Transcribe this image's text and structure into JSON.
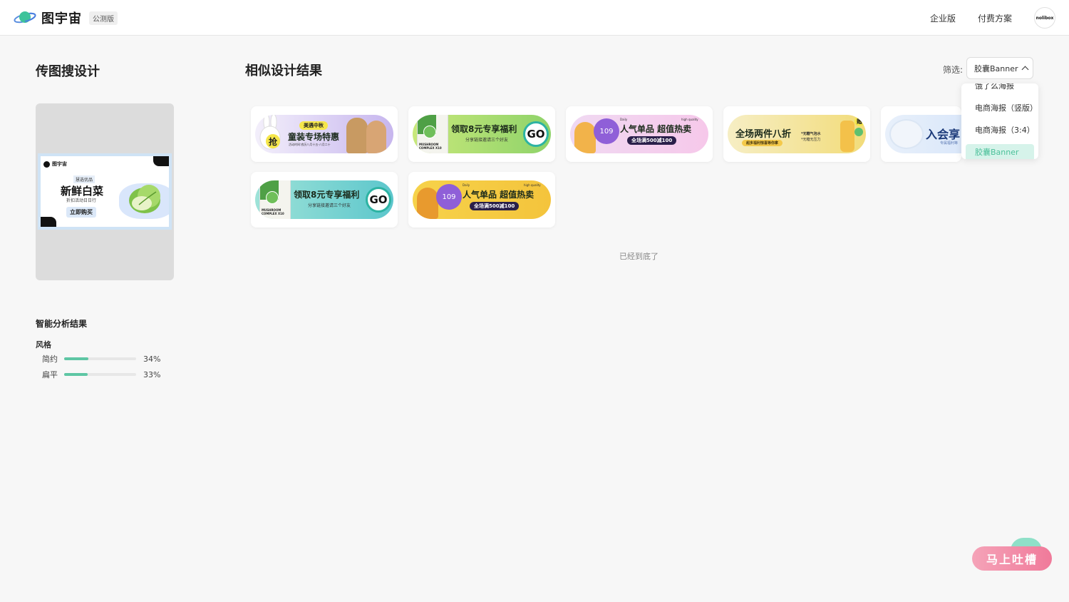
{
  "header": {
    "app_name": "图宇宙",
    "beta_label": "公测版",
    "nav": [
      "企业版",
      "付费方案"
    ],
    "avatar_text": "nolibox"
  },
  "left": {
    "title": "传图搜设计",
    "query_image": {
      "logo": "图宇宙",
      "tag": "慧选优品",
      "title": "新鲜白菜",
      "subtitle": "折扣活动日日行",
      "button": "立即购买"
    },
    "analysis_title": "智能分析结果",
    "style_label": "风格",
    "metrics": [
      {
        "name": "简约",
        "value": "34%",
        "fraction": 0.34
      },
      {
        "name": "扁平",
        "value": "33%",
        "fraction": 0.33
      }
    ]
  },
  "main": {
    "title": "相似设计结果",
    "filter_label": "筛选:",
    "filter_value": "胶囊Banner",
    "dropdown": [
      "饿了么海报",
      "电商海报（竖版）",
      "电商海报（3:4）",
      "胶囊Banner"
    ],
    "end_text": "已经到底了",
    "results": [
      {
        "tag": "美遇中秋",
        "badge": "抢",
        "title": "童装专场特惠",
        "sub": "活动时间:农历八月十五-八月二十"
      },
      {
        "title": "领取8元专享福利",
        "sub": "分享链接邀请三个好友",
        "go": "GO",
        "box": "MUSHROOM COMPLEX X10"
      },
      {
        "price": "109",
        "title": "人气单品  超值热卖",
        "pill": "全场满500减100",
        "daily": "Daily",
        "hq": "high quality"
      },
      {
        "title": "全场两件八折",
        "sub": "超多福利惊喜等你拿",
        "note1": "*无糖气泡水",
        "note2": "*无糖无压力",
        "gift": "赠"
      },
      {
        "title": "入会享",
        "sub": "专属福利等"
      },
      {
        "title": "领取8元专享福利",
        "sub": "分享链接邀请三个好友",
        "go": "GO",
        "box": "MUSHROOM COMPLEX X10"
      },
      {
        "price": "109",
        "title": "人气单品  超值热卖",
        "pill": "全场满500减100",
        "daily": "Daily",
        "hq": "high quality"
      }
    ]
  },
  "feedback": "马上吐槽",
  "colors": {
    "accent": "#5ec6a4",
    "feedback": "#f07a9a",
    "active_bg": "#d6f3ea"
  }
}
